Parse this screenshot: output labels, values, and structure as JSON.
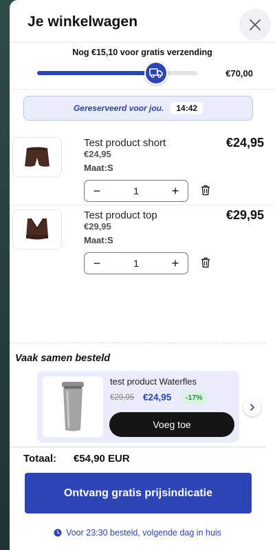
{
  "cart": {
    "title": "Je winkelwagen",
    "shipping": {
      "message": "Nog €15,10 voor gratis verzending",
      "threshold": "€70,00",
      "progress_fraction": 0.784
    },
    "reservation": {
      "text": "Gereserveerd voor jou.",
      "timer": "14:42"
    },
    "items": [
      {
        "name": "Test product short",
        "unit_price": "€24,95",
        "size": "Maat:S",
        "quantity": "1",
        "line_total": "€24,95",
        "icon": "shorts-image"
      },
      {
        "name": "Test product top",
        "unit_price": "€29,95",
        "size": "Maat:S",
        "quantity": "1",
        "line_total": "€29,95",
        "icon": "sports-bra-image"
      }
    ],
    "upsell": {
      "heading": "Vaak samen besteld",
      "product": {
        "name": "test product Waterfles",
        "old_price": "€29,95",
        "new_price": "€24,95",
        "discount": "-17%",
        "button": "Voeg toe",
        "icon": "tumbler-image"
      }
    },
    "total": {
      "label": "Totaal:",
      "value": "€54,90 EUR"
    },
    "cta": "Ontvang gratis prijsindicatie",
    "delivery": "Voor 23:30 besteld, volgende dag in huis"
  },
  "colors": {
    "accent": "#2d44b4",
    "accent_light": "#e8ecfb",
    "discount_bg": "#d9f3df",
    "discount_text": "#1f8a3d",
    "product_brown": "#4a2b22"
  }
}
